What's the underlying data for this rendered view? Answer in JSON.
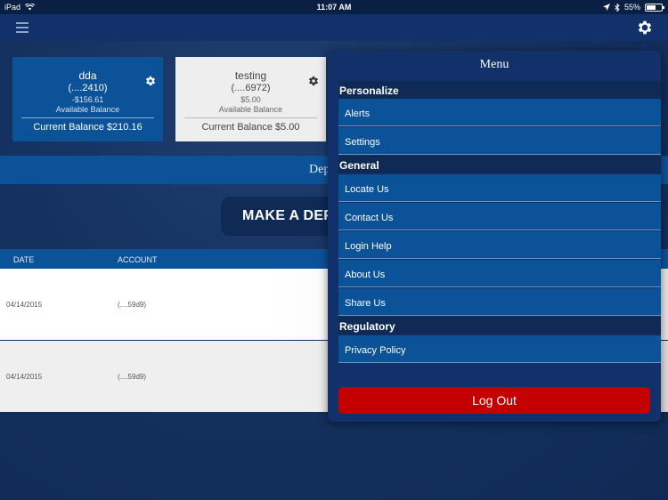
{
  "status_bar": {
    "device": "iPad",
    "time": "11:07 AM",
    "battery": "55%"
  },
  "accounts": [
    {
      "name": "dda",
      "number": "(....2410)",
      "available_amount": "-$156.61",
      "available_label": "Available Balance",
      "current_balance": "Current Balance $210.16"
    },
    {
      "name": "testing",
      "number": "(....6972)",
      "available_amount": "$5.00",
      "available_label": "Available Balance",
      "current_balance": "Current Balance $5.00"
    }
  ],
  "deposit_band_title": "Dep",
  "make_deposit_label": "MAKE A DEP",
  "table": {
    "headers": [
      "DATE",
      "ACCOUNT"
    ],
    "rows": [
      {
        "date": "04/14/2015",
        "account": "(....59d9)"
      },
      {
        "date": "04/14/2015",
        "account": "(....59d9)"
      }
    ]
  },
  "menu": {
    "title": "Menu",
    "sections": [
      {
        "label": "Personalize",
        "items": [
          "Alerts",
          "Settings"
        ]
      },
      {
        "label": "General",
        "items": [
          "Locate Us",
          "Contact Us",
          "Login Help",
          "About Us",
          "Share Us"
        ]
      },
      {
        "label": "Regulatory",
        "items": [
          "Privacy Policy"
        ]
      }
    ],
    "logout_label": "Log Out"
  },
  "colors": {
    "brand_blue": "#0b5299",
    "navy": "#12306a",
    "logout_red": "#c40000"
  }
}
